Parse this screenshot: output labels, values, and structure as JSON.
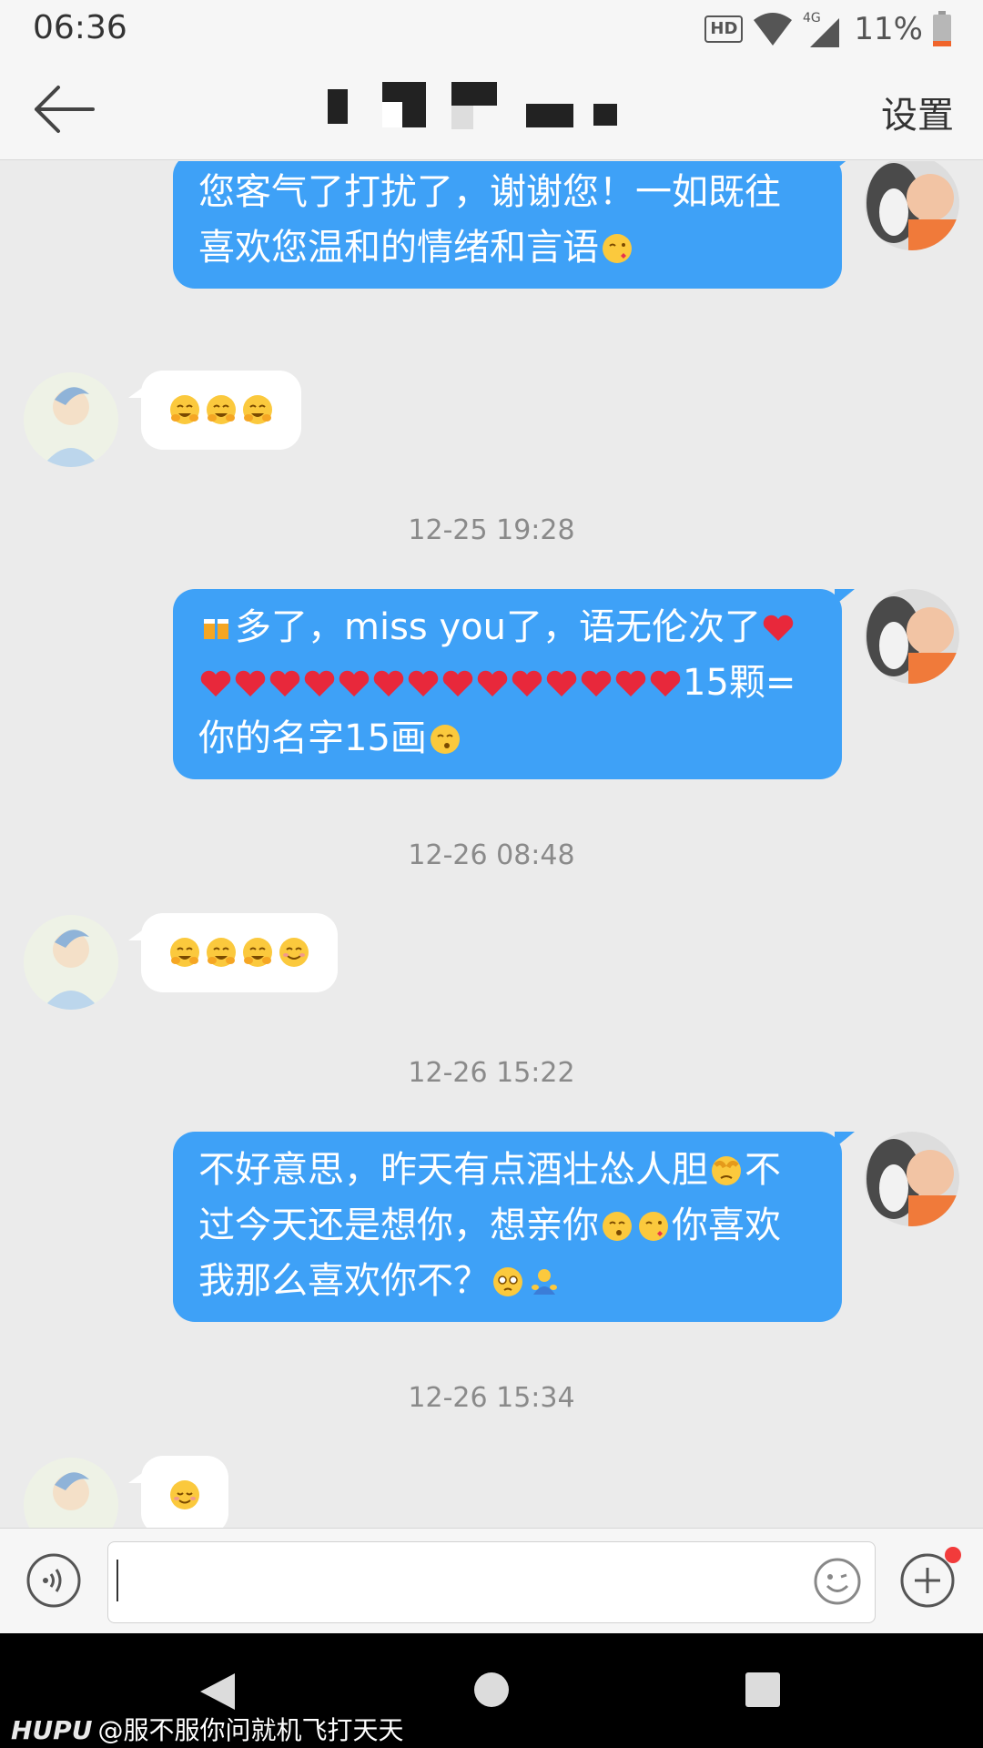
{
  "status_bar": {
    "time": "06:36",
    "hd_badge": "HD",
    "network": "4G",
    "battery_percent": "11%"
  },
  "nav": {
    "settings_label": "设置"
  },
  "messages": [
    {
      "side": "me",
      "text": "您客气了打扰了，谢谢您！一如既往喜欢您温和的情绪和言语"
    },
    {
      "side": "her",
      "emojis": [
        "hugging-face-icon",
        "hugging-face-icon",
        "hugging-face-icon"
      ]
    },
    {
      "timestamp": "12-25 19:28"
    },
    {
      "side": "me",
      "lines": [
        "多了，miss you了，语无伦次了",
        "15颗=",
        "你的名字15画"
      ],
      "hearts": 15
    },
    {
      "timestamp": "12-26 08:48"
    },
    {
      "side": "her",
      "emojis": [
        "hugging-face-icon",
        "hugging-face-icon",
        "hugging-face-icon",
        "smiling-face-icon"
      ]
    },
    {
      "timestamp": "12-26 15:22"
    },
    {
      "side": "me",
      "segments": [
        "不好意思，昨天有点酒壮怂人胆",
        "不过今天还是想你，想亲你",
        "你喜欢我那么喜欢你不？"
      ]
    },
    {
      "timestamp": "12-26 15:34"
    },
    {
      "side": "her",
      "emojis": [
        "shy-smile-icon"
      ]
    }
  ],
  "msg1": {
    "text": "您客气了打扰了，谢谢您！一如既往喜欢您温和的情绪和言语"
  },
  "msg4": {
    "line1": "多了，miss you了，语无伦次了",
    "line2_tail": "15颗=",
    "line3": "你的名字15画"
  },
  "msg6": {
    "part1": "不好意思，昨天有点酒壮怂人胆",
    "part2": "不过今天还是想你，想亲你",
    "part3": "你喜欢我那么喜欢你不？"
  },
  "timestamps": {
    "t1": "12-25 19:28",
    "t2": "12-26 08:48",
    "t3": "12-26 15:22",
    "t4": "12-26 15:34"
  },
  "input": {
    "value": ""
  },
  "watermark": {
    "brand": "HUPU",
    "text": "@服不服你问就机飞打天天"
  },
  "colors": {
    "sent_bubble": "#3ea1f7",
    "received_bubble": "#ffffff",
    "background": "#ebebeb",
    "badge_red": "#f23b3b"
  }
}
